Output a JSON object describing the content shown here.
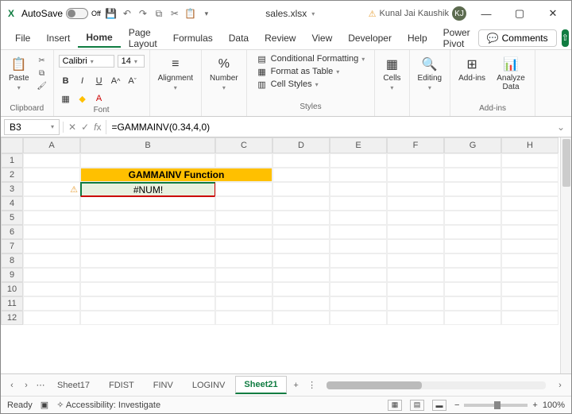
{
  "titlebar": {
    "autosave_label": "AutoSave",
    "autosave_state": "Off",
    "filename": "sales.xlsx",
    "user_name": "Kunal Jai Kaushik",
    "user_initials": "KJ"
  },
  "menubar": {
    "items": [
      "File",
      "Insert",
      "Home",
      "Page Layout",
      "Formulas",
      "Data",
      "Review",
      "View",
      "Developer",
      "Help",
      "Power Pivot"
    ],
    "active": "Home",
    "comments": "Comments"
  },
  "ribbon": {
    "clipboard": {
      "paste": "Paste",
      "label": "Clipboard"
    },
    "font": {
      "name": "Calibri",
      "size": "14",
      "label": "Font"
    },
    "alignment": {
      "label": "Alignment"
    },
    "number": {
      "label": "Number"
    },
    "styles": {
      "conditional": "Conditional Formatting",
      "table": "Format as Table",
      "cell": "Cell Styles",
      "label": "Styles"
    },
    "cells": {
      "label": "Cells"
    },
    "editing": {
      "label": "Editing"
    },
    "addins": {
      "btn": "Add-ins",
      "analyze": "Analyze Data",
      "label": "Add-ins"
    }
  },
  "formula_bar": {
    "name_box": "B3",
    "formula": "=GAMMAINV(0.34,4,0)"
  },
  "grid": {
    "cols": [
      "A",
      "B",
      "C",
      "D",
      "E",
      "F",
      "G",
      "H"
    ],
    "rows": [
      1,
      2,
      3,
      4,
      5,
      6,
      7,
      8,
      9,
      10,
      11,
      12
    ],
    "header_text": "GAMMAINV Function",
    "error_value": "#NUM!"
  },
  "tabs": {
    "sheets": [
      "Sheet17",
      "FDIST",
      "FINV",
      "LOGINV",
      "Sheet21"
    ],
    "active": "Sheet21"
  },
  "status": {
    "ready": "Ready",
    "accessibility": "Accessibility: Investigate",
    "zoom": "100%"
  }
}
